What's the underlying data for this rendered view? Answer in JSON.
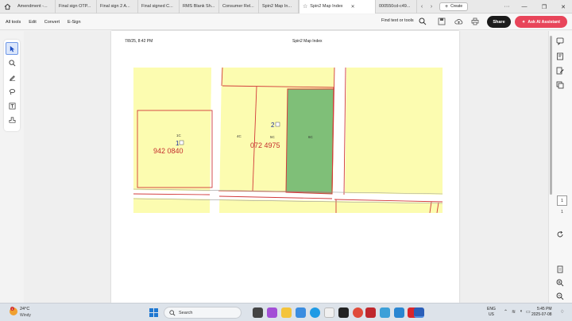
{
  "tabs": [
    {
      "label": "Amendment -..."
    },
    {
      "label": "Final sign OTP..."
    },
    {
      "label": "Final sign 2 A..."
    },
    {
      "label": "Final signed C..."
    },
    {
      "label": "RMS Blank Sh..."
    },
    {
      "label": "Consumer Rel..."
    },
    {
      "label": "Spin2 Map In..."
    },
    {
      "label": "Spin2 Map Index"
    },
    {
      "label": "000550cd-c49..."
    }
  ],
  "create_label": "Create",
  "menu": {
    "items": [
      "All tools",
      "Edit",
      "Convert",
      "E-Sign"
    ],
    "find_text": "Find text or tools",
    "share": "Share",
    "ai": "Ask AI Assistant"
  },
  "document": {
    "date": "7/8/25, 8:42 PM",
    "title": "Spin2 Map Index"
  },
  "map": {
    "colors": {
      "parcel": "#fcfcb0",
      "highlight": "#7fbf78",
      "line": "#d23a3a",
      "road": "#ffffff"
    },
    "labels": {
      "lot_1c": "1C",
      "lot_1": "1",
      "lot_1_id": "942 0840",
      "lot_4c": "4C",
      "lot_5c": "5C",
      "lot_2": "2",
      "lot_2_id": "072 4975",
      "lot_6c": "6C"
    }
  },
  "page_nav": {
    "current": "1",
    "total": "1"
  },
  "taskbar": {
    "weather_badge": "1",
    "temp": "24°C",
    "condition": "Windy",
    "search": "Search",
    "lang_1": "ENG",
    "lang_2": "US",
    "time": "5:45 PM",
    "date": "2025-07-08"
  }
}
